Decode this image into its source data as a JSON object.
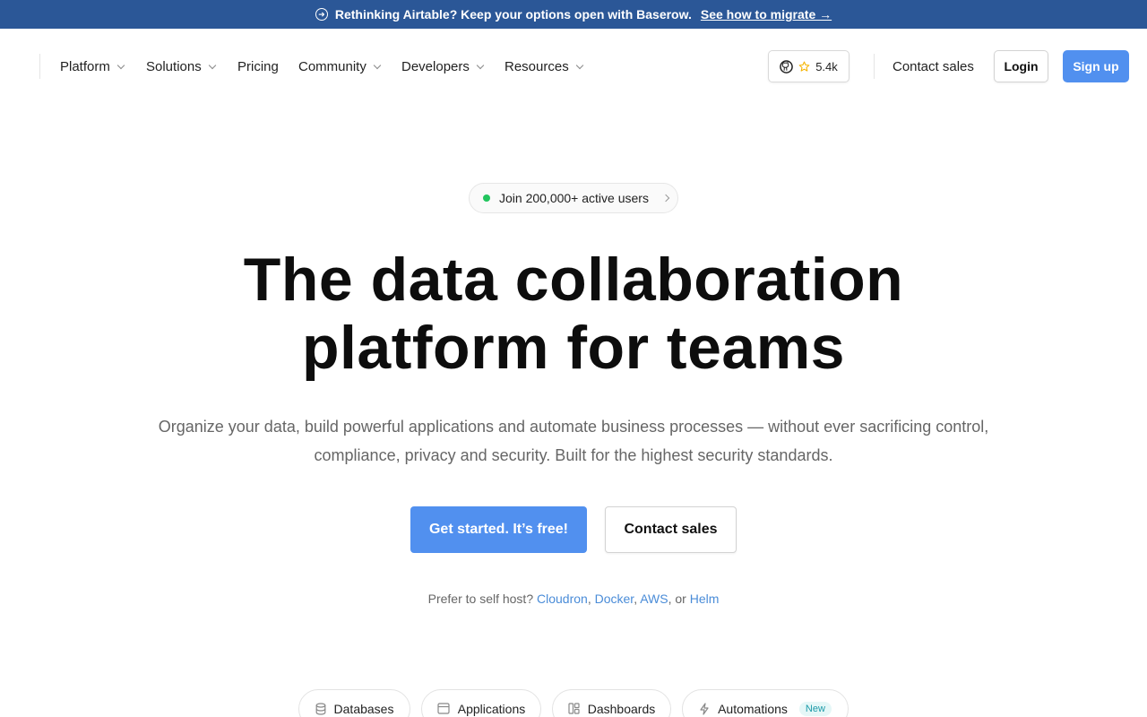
{
  "banner": {
    "text": "Rethinking Airtable? Keep your options open with Baserow.",
    "link": "See how to migrate →"
  },
  "nav": {
    "items": [
      {
        "label": "Platform",
        "dropdown": true
      },
      {
        "label": "Solutions",
        "dropdown": true
      },
      {
        "label": "Pricing",
        "dropdown": false
      },
      {
        "label": "Community",
        "dropdown": true
      },
      {
        "label": "Developers",
        "dropdown": true
      },
      {
        "label": "Resources",
        "dropdown": true
      }
    ],
    "github_stars": "5.4k",
    "contact_sales": "Contact sales",
    "login": "Login",
    "signup": "Sign up"
  },
  "hero": {
    "pill": "Join 200,000+ active users",
    "title_line1": "The data collaboration",
    "title_line2": "platform for teams",
    "subtitle_line1": "Organize your data, build powerful applications and automate business processes — without ever sacrificing control,",
    "subtitle_line2": "compliance, privacy and security. Built for the highest security standards.",
    "cta_primary": "Get started. It’s free!",
    "cta_secondary": "Contact sales",
    "selfhost_prefix": "Prefer to self host?",
    "selfhost_links": [
      "Cloudron",
      "Docker",
      "AWS",
      "Helm"
    ],
    "selfhost_or": "or"
  },
  "tabs": [
    {
      "label": "Databases",
      "icon": "database-icon"
    },
    {
      "label": "Applications",
      "icon": "window-icon"
    },
    {
      "label": "Dashboards",
      "icon": "dashboard-icon"
    },
    {
      "label": "Automations",
      "icon": "lightning-icon",
      "badge": "New"
    }
  ],
  "colors": {
    "banner_bg": "#2b5797",
    "primary": "#5190ef",
    "link": "#4a8cd8",
    "status_dot": "#22c55e",
    "star": "#f5b400"
  }
}
